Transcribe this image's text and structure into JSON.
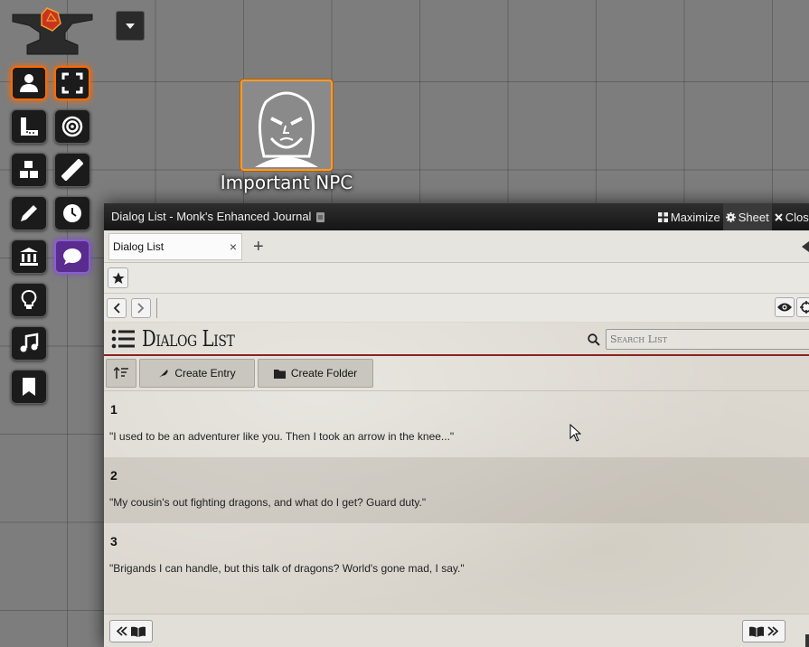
{
  "toolbar": {
    "tools": [
      {
        "name": "token-controls",
        "icon": "person-icon",
        "active": true
      },
      {
        "name": "fullscreen",
        "icon": "expand-icon",
        "active": true
      },
      {
        "name": "measure",
        "icon": "ruler-combined-icon"
      },
      {
        "name": "target",
        "icon": "bullseye-icon"
      },
      {
        "name": "tiles",
        "icon": "cubes-icon"
      },
      {
        "name": "ruler",
        "icon": "ruler-icon"
      },
      {
        "name": "drawing",
        "icon": "pencil-icon"
      },
      {
        "name": "time",
        "icon": "clock-icon"
      },
      {
        "name": "journal",
        "icon": "landmark-icon"
      },
      {
        "name": "dialog",
        "icon": "comment-icon",
        "active": true
      },
      {
        "name": "lighting",
        "icon": "lightbulb-icon"
      },
      {
        "name": "sounds",
        "icon": "music-icon"
      },
      {
        "name": "notes",
        "icon": "bookmark-icon"
      }
    ],
    "accent_color": "#ff6a00",
    "dialog_color": "#5b2c8f"
  },
  "token": {
    "label": "Important NPC"
  },
  "window": {
    "title": "Dialog List - Monk's Enhanced Journal",
    "maximize_label": "Maximize",
    "sheet_label": "Sheet",
    "close_label": "Close",
    "tab_label": "Dialog List",
    "page_title": "Dialog List",
    "search_placeholder": "Search List",
    "create_entry_label": "Create Entry",
    "create_folder_label": "Create Folder",
    "accent_line_color": "#8b2222"
  },
  "entries": [
    {
      "number": "1",
      "text": "\"I used to be an adventurer like you. Then I took an arrow in the knee...\""
    },
    {
      "number": "2",
      "text": "\"My cousin's out fighting dragons, and what do I get? Guard duty.\""
    },
    {
      "number": "3",
      "text": "\"Brigands I can handle, but this talk of dragons? World's gone mad, I say.\""
    }
  ]
}
